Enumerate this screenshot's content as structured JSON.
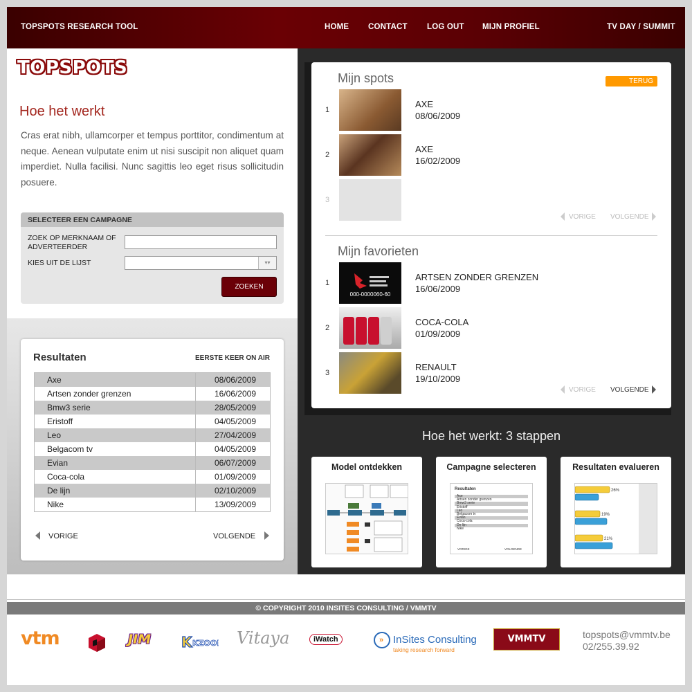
{
  "header": {
    "app_title": "TOPSPOTS RESEARCH TOOL",
    "nav": [
      "HOME",
      "CONTACT",
      "LOG OUT",
      "MIJN PROFIEL"
    ],
    "right_link": "TV DAY / SUMMIT"
  },
  "logo": "TOPSPOTS",
  "how_it_works": {
    "title": "Hoe het werkt",
    "text": "Cras erat nibh, ullamcorper et tempus porttitor, condimentum at neque. Aenean vulputate enim ut nisi suscipit non aliquet quam imperdiet. Nulla facilisi. Nunc sagittis leo eget risus sollicitudin posuere."
  },
  "campaign_form": {
    "heading": "SELECTEER EEN CAMPAGNE",
    "search_label": "ZOEK OP MERKNAAM OF ADVERTEERDER",
    "search_value": "",
    "list_label": "KIES UIT DE LIJST",
    "list_value": "",
    "submit_label": "ZOEKEN"
  },
  "results": {
    "title": "Resultaten",
    "column_label": "EERSTE KEER ON AIR",
    "rows": [
      {
        "name": "Axe",
        "date": "08/06/2009"
      },
      {
        "name": "Artsen zonder grenzen",
        "date": "16/06/2009"
      },
      {
        "name": "Bmw3 serie",
        "date": "28/05/2009"
      },
      {
        "name": "Eristoff",
        "date": "04/05/2009"
      },
      {
        "name": "Leo",
        "date": "27/04/2009"
      },
      {
        "name": "Belgacom tv",
        "date": "04/05/2009"
      },
      {
        "name": "Evian",
        "date": "06/07/2009"
      },
      {
        "name": "Coca-cola",
        "date": "01/09/2009"
      },
      {
        "name": "De lijn",
        "date": "02/10/2009"
      },
      {
        "name": "Nike",
        "date": "13/09/2009"
      }
    ],
    "prev_label": "VORIGE",
    "next_label": "VOLGENDE"
  },
  "my_spots": {
    "title": "Mijn spots",
    "back_label": "TERUG",
    "items": [
      {
        "index": "1",
        "brand": "AXE",
        "date": "08/06/2009",
        "thumb_color": "#b58a62"
      },
      {
        "index": "2",
        "brand": "AXE",
        "date": "16/02/2009",
        "thumb_color": "#8a5a3a"
      },
      {
        "index": "3",
        "brand": "",
        "date": "",
        "thumb_color": "#e6e6e6"
      }
    ],
    "prev_label": "VORIGE",
    "next_label": "VOLGENDE"
  },
  "my_favorites": {
    "title": "Mijn favorieten",
    "items": [
      {
        "index": "1",
        "brand": "ARTSEN ZONDER GRENZEN",
        "date": "16/06/2009",
        "thumb_color": "#0b0b0b",
        "thumb_text": "000-0000060-60"
      },
      {
        "index": "2",
        "brand": "COCA-COLA",
        "date": "01/09/2009",
        "thumb_color": "#b0b0b0",
        "thumb_text": ""
      },
      {
        "index": "3",
        "brand": "RENAULT",
        "date": "19/10/2009",
        "thumb_color": "#7a6a3a",
        "thumb_text": ""
      }
    ],
    "prev_label": "VORIGE",
    "next_label": "VOLGENDE"
  },
  "steps": {
    "title": "Hoe het werkt: 3 stappen",
    "cards": [
      {
        "title": "Model ontdekken"
      },
      {
        "title": "Campagne selecteren",
        "mini_heading": "Resultaten",
        "mini_rows": [
          "Axe",
          "Artsen zonder grenzen",
          "Bmw3 serie",
          "Eristoff",
          "Leo",
          "Belgacom tv",
          "Evian",
          "Coca-cola",
          "De lijn",
          "Nike"
        ],
        "mini_prev": "VORIGE",
        "mini_next": "VOLGENDE"
      },
      {
        "title": "Resultaten evalueren",
        "bar_labels": [
          "26%",
          "19%",
          "21%"
        ]
      }
    ]
  },
  "footer": {
    "copyright": "© COPYRIGHT 2010 INSITES CONSULTING  /  VMMTV",
    "logos": [
      "vtm",
      "JIM",
      "Vitaya",
      "iWatch",
      "InSites Consulting",
      "taking research forward",
      "VMMTV",
      "KZOOM"
    ],
    "email": "topspots@vmmtv.be",
    "phone": "02/255.39.92"
  },
  "colors": {
    "brand_red": "#6b0007",
    "accent_orange": "#ff9900",
    "heading_red": "#a3261e"
  }
}
